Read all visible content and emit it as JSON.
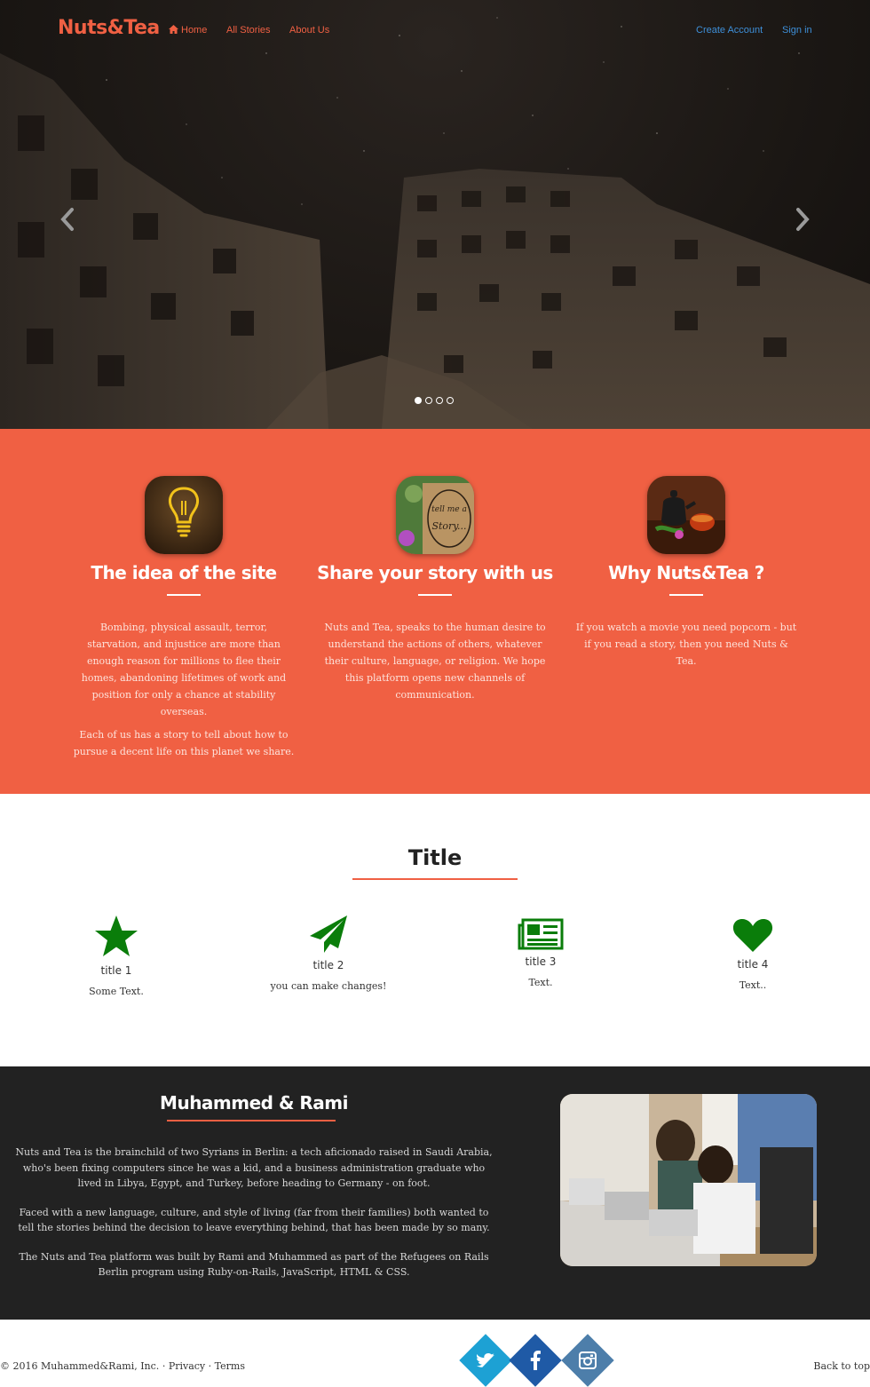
{
  "nav": {
    "brand": "Nuts&Tea",
    "home": "Home",
    "all_stories": "All Stories",
    "about_us": "About Us",
    "create_account": "Create Account",
    "sign_in": "Sign in"
  },
  "carousel": {
    "slides": 4,
    "active": 1
  },
  "features": [
    {
      "title": "The idea of the site",
      "paragraphs": [
        "Bombing, physical assault, terror, starvation, and injustice are more than enough reason for millions to flee their homes, abandoning lifetimes of work and position for only a chance at stability overseas.",
        "Each of us has a story to tell about how to pursue a decent life on this planet we share."
      ]
    },
    {
      "title": "Share your story with us",
      "paragraphs": [
        "Nuts and Tea, speaks to the human desire to understand the actions of others, whatever their culture, language, or religion. We hope this platform opens new channels of communication."
      ],
      "image_text": [
        "tell me a",
        "Story..."
      ]
    },
    {
      "title": "Why Nuts&Tea ?",
      "paragraphs": [
        "If you watch a movie you need popcorn - but if you read a story, then you need Nuts & Tea."
      ]
    }
  ],
  "services": {
    "title": "Title",
    "items": [
      {
        "icon": "star-icon",
        "title": "title 1",
        "text": "Some Text."
      },
      {
        "icon": "paper-plane-icon",
        "title": "title 2",
        "text": "you can make changes!"
      },
      {
        "icon": "newspaper-icon",
        "title": "title 3",
        "text": "Text."
      },
      {
        "icon": "heart-icon",
        "title": "title 4",
        "text": "Text.."
      }
    ],
    "icon_color": "#0a7d0a"
  },
  "about": {
    "title": "Muhammed & Rami",
    "paragraphs": [
      "Nuts and Tea is the brainchild of two Syrians in Berlin: a tech aficionado raised in Saudi Arabia, who's been fixing computers since he was a kid, and a business administration graduate who lived in Libya, Egypt, and Turkey, before heading to Germany - on foot.",
      "Faced with a new language, culture, and style of living (far from their families) both wanted to tell the stories behind the decision to leave everything behind, that has been made by so many.",
      "The Nuts and Tea platform was built by Rami and Muhammed as part of the Refugees on Rails Berlin program using Ruby-on-Rails, JavaScript, HTML & CSS."
    ]
  },
  "footer": {
    "copyright": "© 2016 Muhammed&Rami, Inc.",
    "privacy": "Privacy",
    "terms": "Terms",
    "separator": "·",
    "back_to_top": "Back to top",
    "social": [
      "twitter-icon",
      "facebook-icon",
      "instagram-icon"
    ]
  },
  "colors": {
    "brand": "#f06043",
    "link_blue": "#3e8fd8",
    "dark_section": "#222222",
    "twitter": "#1da1d4",
    "facebook": "#1f5aa6",
    "instagram": "#4d7eaa"
  }
}
